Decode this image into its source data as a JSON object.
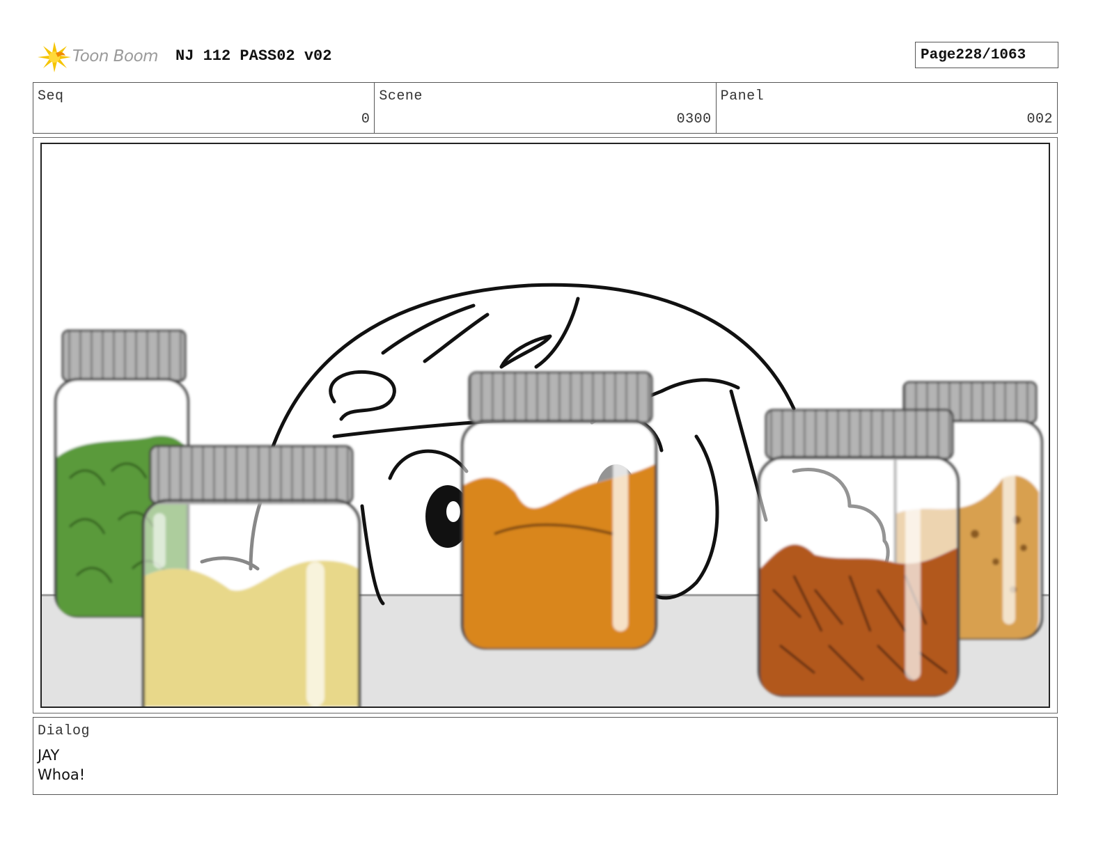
{
  "header": {
    "brand": "Toon Boom",
    "title": "NJ 112 PASS02 v02",
    "page_label": "Page",
    "page_number": "228/1063"
  },
  "info": {
    "seq_label": "Seq",
    "seq_value": "0",
    "scene_label": "Scene",
    "scene_value": "0300",
    "panel_label": "Panel",
    "panel_value": "002"
  },
  "dialog": {
    "label": "Dialog",
    "speaker": "JAY",
    "line": "Whoa!"
  },
  "colors": {
    "brand_yellow": "#f5c400",
    "green_leaves": "#5a9a3a",
    "cream_powder": "#e8d88a",
    "orange_spice": "#d9861e",
    "brown_seeds": "#b2581f",
    "tan_spice": "#d8a050",
    "jar_lid": "#a8a8a8",
    "counter": "#e2e2e2"
  }
}
